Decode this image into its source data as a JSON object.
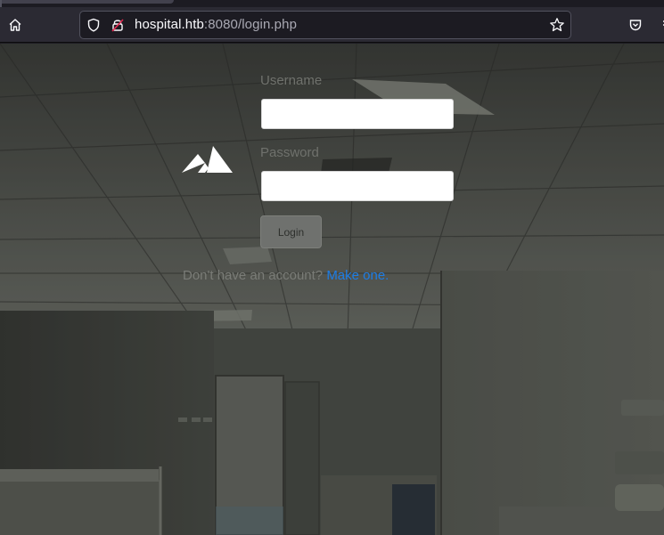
{
  "browser": {
    "url_host": "hospital.htb",
    "url_rest": ":8080/login.php",
    "icons": [
      "home-icon",
      "shield-icon",
      "lock-warning-icon",
      "star-icon",
      "pocket-icon"
    ]
  },
  "form": {
    "username_label": "Username",
    "username_value": "",
    "password_label": "Password",
    "password_value": "",
    "login_button": "Login",
    "signup_prompt": "Don't have an account? ",
    "signup_link": "Make one."
  },
  "colors": {
    "link": "#1d7de6",
    "button": "#6f716e",
    "label": "#6f716c"
  }
}
